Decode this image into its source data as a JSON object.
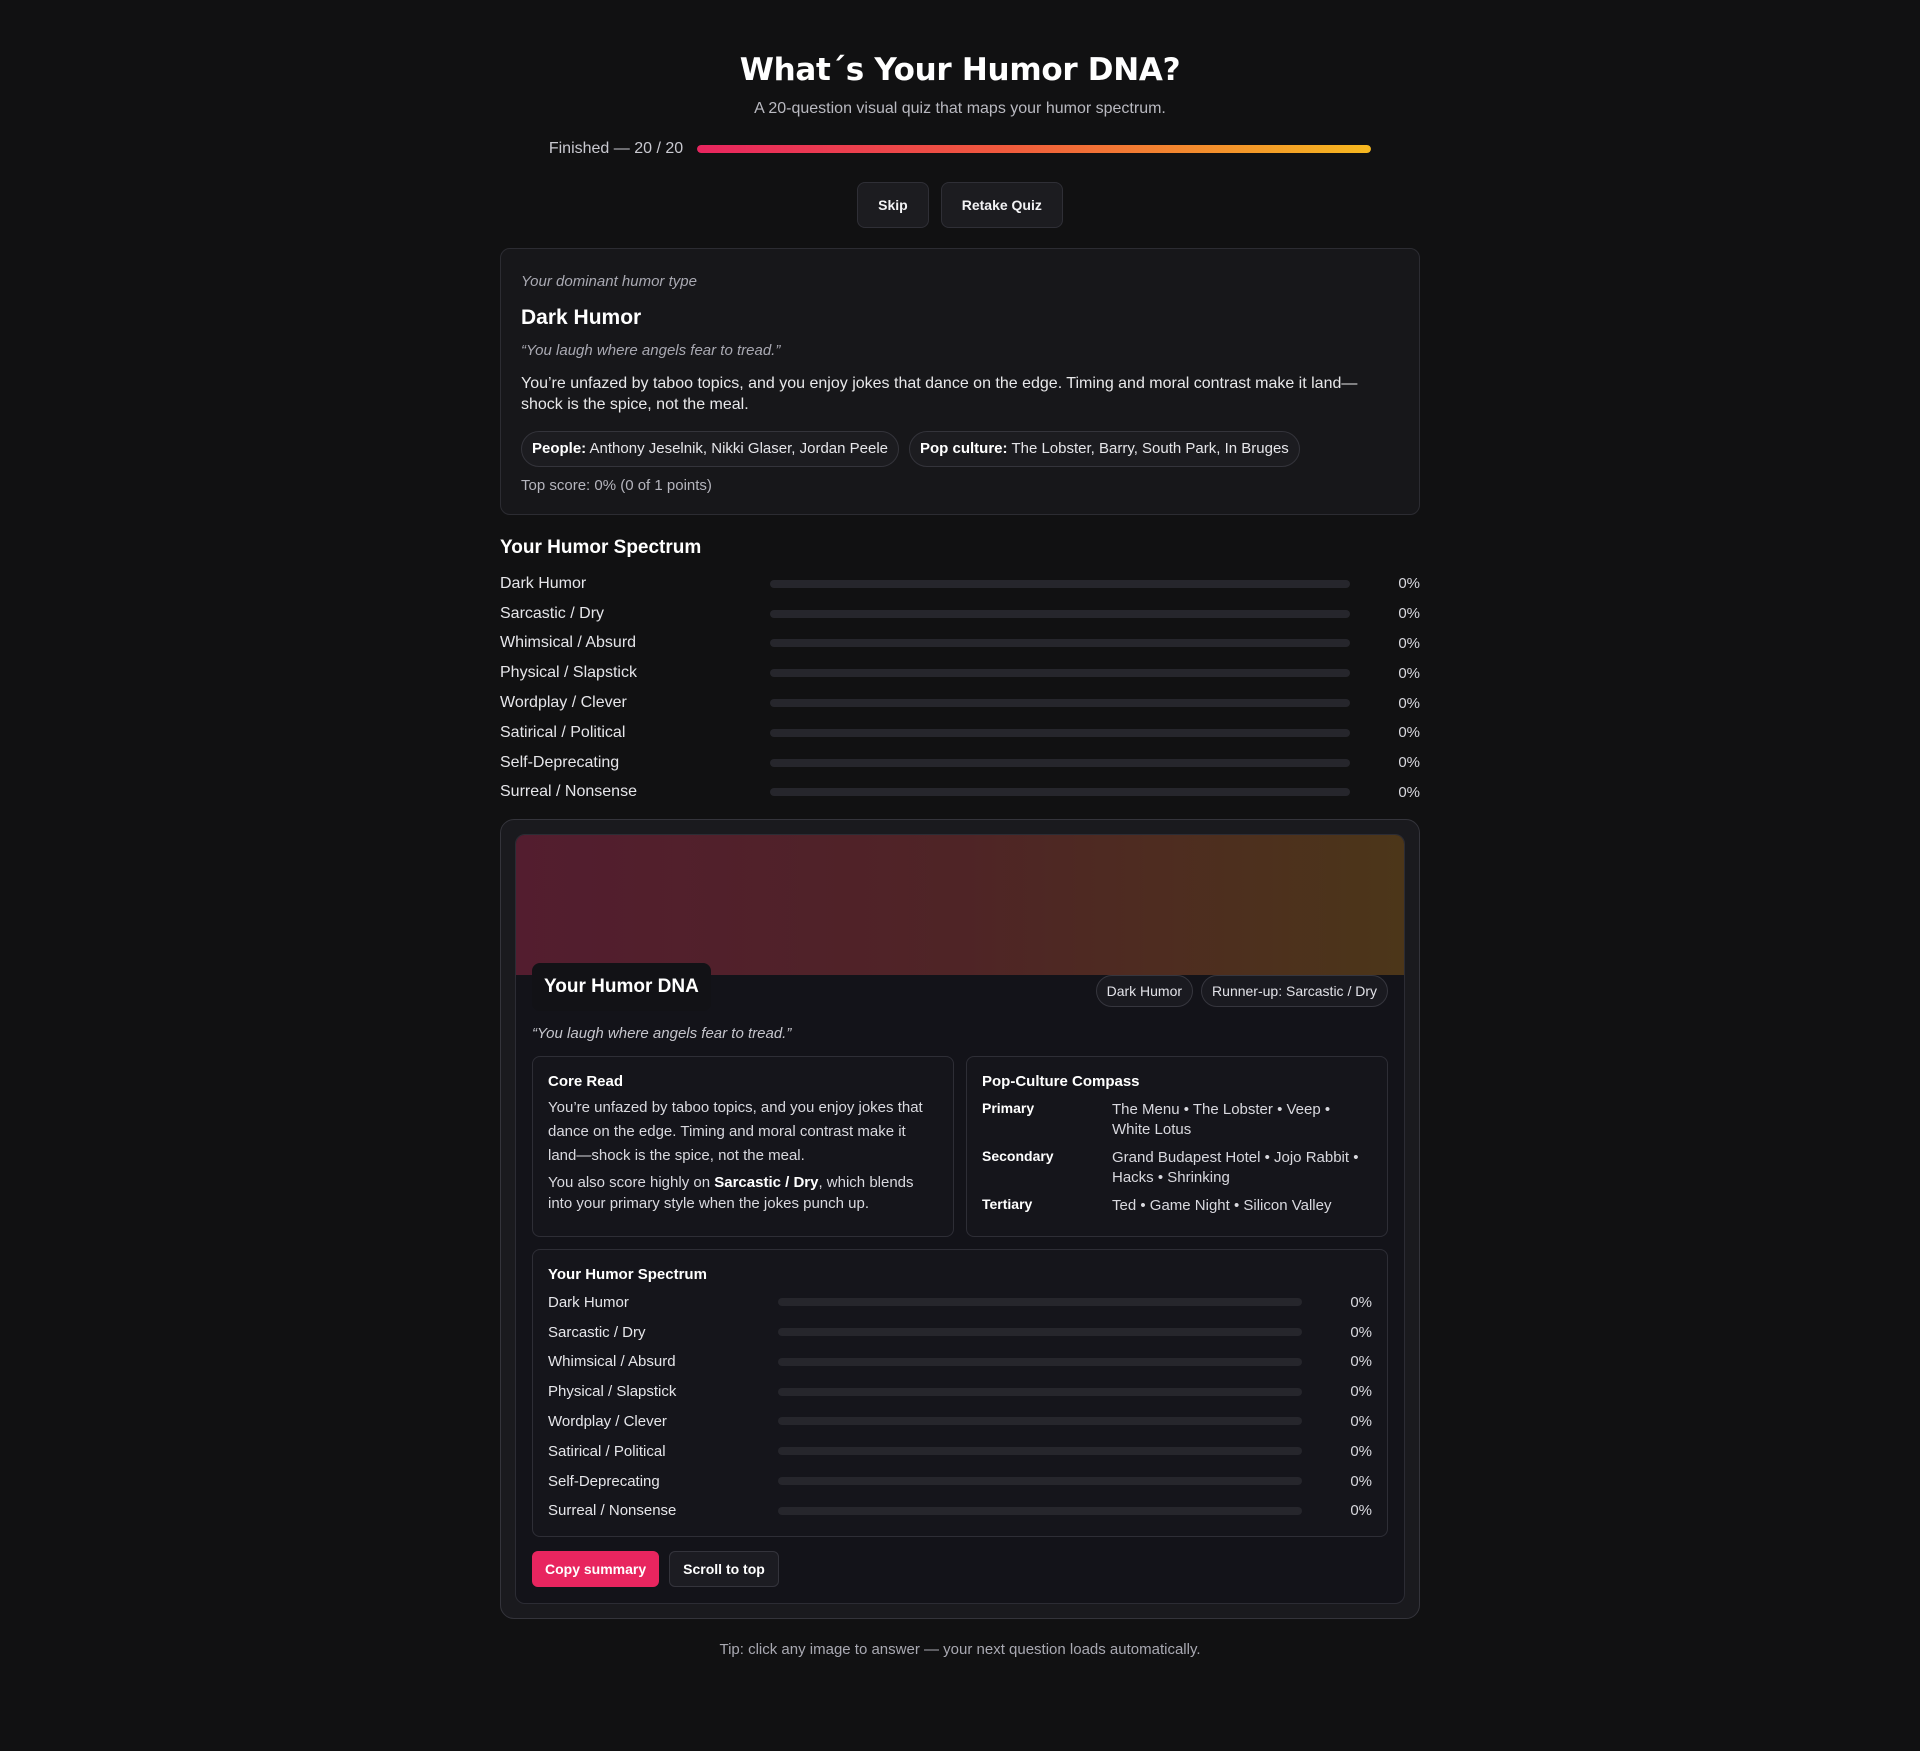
{
  "header": {
    "title": "What´s Your Humor DNA?",
    "subtitle": "A 20-question visual quiz that maps your humor spectrum."
  },
  "progress": {
    "label": "Finished — 20 / 20",
    "fraction": 1.0
  },
  "buttons": {
    "skip": "Skip",
    "retake": "Retake Quiz"
  },
  "result": {
    "kicker": "Your dominant humor type",
    "type_name": "Dark Humor",
    "quote": "“You laugh where angels fear to tread.”",
    "description": "You’re unfazed by taboo topics, and you enjoy jokes that dance on the edge. Timing and moral contrast make it land—shock is the spice, not the meal.",
    "people_label": "People:",
    "people": "Anthony Jeselnik, Nikki Glaser, Jordan Peele",
    "pop_label": "Pop culture:",
    "pop": "The Lobster, Barry, South Park, In Bruges",
    "top_score": "Top score: 0% (0 of 1 points)"
  },
  "spectrum": {
    "title": "Your Humor Spectrum",
    "items": [
      {
        "label": "Dark Humor",
        "pct": "0%",
        "value": 0
      },
      {
        "label": "Sarcastic / Dry",
        "pct": "0%",
        "value": 0
      },
      {
        "label": "Whimsical / Absurd",
        "pct": "0%",
        "value": 0
      },
      {
        "label": "Physical / Slapstick",
        "pct": "0%",
        "value": 0
      },
      {
        "label": "Wordplay / Clever",
        "pct": "0%",
        "value": 0
      },
      {
        "label": "Satirical / Political",
        "pct": "0%",
        "value": 0
      },
      {
        "label": "Self-Deprecating",
        "pct": "0%",
        "value": 0
      },
      {
        "label": "Surreal / Nonsense",
        "pct": "0%",
        "value": 0
      }
    ]
  },
  "dna_card": {
    "title": "Your Humor DNA",
    "badge_primary": "Dark Humor",
    "badge_runner": "Runner-up: Sarcastic / Dry",
    "quote": "“You laugh where angels fear to tread.”",
    "core_read": {
      "title": "Core Read",
      "text": "You’re unfazed by taboo topics, and you enjoy jokes that dance on the edge. Timing and moral contrast make it land—shock is the spice, not the meal.",
      "also_prefix": "You also score highly on ",
      "also_highlight": "Sarcastic / Dry",
      "also_suffix": ", which blends into your primary style when the jokes punch up."
    },
    "compass": {
      "title": "Pop-Culture Compass",
      "rows": [
        {
          "key": "Primary",
          "value": "The Menu • The Lobster • Veep • White Lotus"
        },
        {
          "key": "Secondary",
          "value": "Grand Budapest Hotel • Jojo Rabbit • Hacks • Shrinking"
        },
        {
          "key": "Tertiary",
          "value": "Ted • Game Night • Silicon Valley"
        }
      ]
    },
    "spectrum_title": "Your Humor Spectrum",
    "copy_button": "Copy summary",
    "scroll_button": "Scroll to top"
  },
  "tip": "Tip: click any image to answer — your next question loads automatically.",
  "colors": {
    "accent": "#e8255f",
    "gradient_end": "#f6b81f",
    "background": "#111112"
  }
}
